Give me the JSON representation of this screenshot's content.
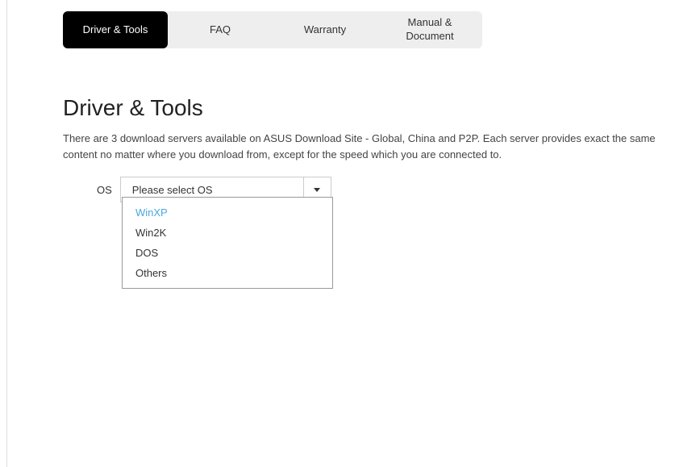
{
  "tabs": {
    "items": [
      {
        "label": "Driver & Tools",
        "active": true
      },
      {
        "label": "FAQ",
        "active": false
      },
      {
        "label": "Warranty",
        "active": false
      },
      {
        "label": "Manual & Document",
        "active": false
      }
    ]
  },
  "heading": "Driver & Tools",
  "description": "There are 3 download servers available on ASUS Download Site - Global, China and P2P. Each server provides exact the same content no matter where you download from, except for the speed which you are connected to.",
  "os": {
    "label": "OS",
    "placeholder": "Please select OS",
    "options": [
      "WinXP",
      "Win2K",
      "DOS",
      "Others"
    ],
    "highlighted_index": 0
  }
}
